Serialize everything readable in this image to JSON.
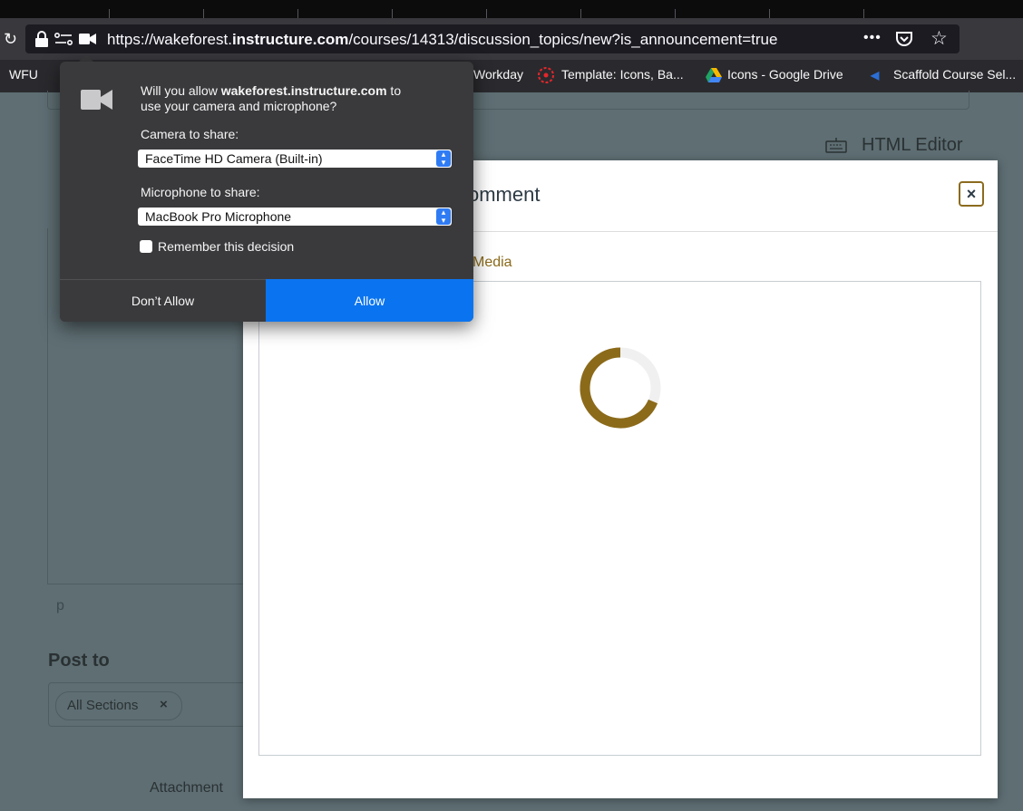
{
  "browser": {
    "url_prefix": "https://wakeforest.",
    "url_domain": "instructure.com",
    "url_path": "/courses/14313/discussion_topics/new?is_announcement=true",
    "menu_icon": "•••",
    "bookmarks": {
      "wfu": "WFU",
      "workday": "Workday",
      "template": "Template: Icons, Ba...",
      "icons_drive": "Icons - Google Drive",
      "scaffold": "Scaffold Course Sel..."
    }
  },
  "page": {
    "html_editor": "HTML Editor",
    "p_label": "p",
    "post_to": "Post to",
    "section_chip": "All Sections",
    "chip_remove": "×",
    "attachment": "Attachment"
  },
  "modal": {
    "title": "omment",
    "close": "×",
    "media_tab": "Media",
    "spinner_color": "#8b6a1a"
  },
  "permission_popup": {
    "question_pre": "Will you allow ",
    "question_domain": "wakeforest.instructure.com",
    "question_post": " to",
    "question_line2": "use your camera and microphone?",
    "camera_label": "Camera to share:",
    "camera_value": "FaceTime HD Camera (Built-in)",
    "mic_label": "Microphone to share:",
    "mic_value": "MacBook Pro Microphone",
    "remember": "Remember this decision",
    "deny": "Don’t Allow",
    "allow": "Allow",
    "accent": "#0a74f0"
  }
}
